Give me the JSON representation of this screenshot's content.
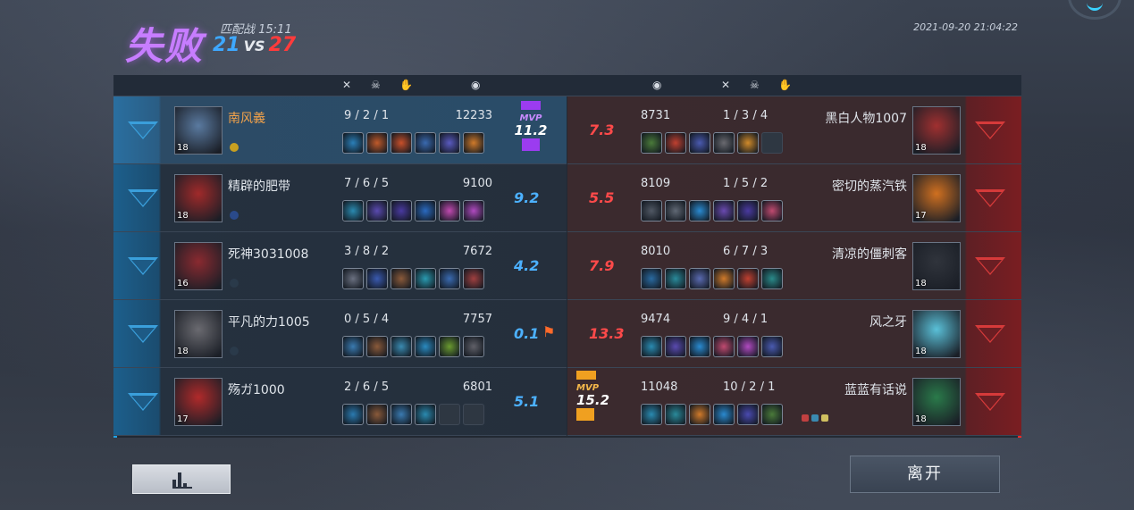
{
  "header": {
    "result": "失败",
    "mode": "匹配战 15:11",
    "score_blue": "21",
    "vs": "VS",
    "score_red": "27",
    "datetime": "2021-09-20 21:04:22"
  },
  "colors": {
    "blue_team": "#1fa4e8",
    "red_team": "#ff2a2a",
    "mvp_loser": "#9b3cf0",
    "mvp_winner": "#f0a020",
    "self_name": "#f2a24a"
  },
  "column_icons": [
    "crossed-swords-icon",
    "skull-icon",
    "assist-hand-icon",
    "coin-icon"
  ],
  "blue_team": [
    {
      "name": "南风義",
      "level": "18",
      "kda": "9 / 2 / 1",
      "gold": "12233",
      "score": "11.2",
      "mvp": "MVP",
      "is_self": true,
      "portrait_color": "#5a7aa0",
      "items": [
        "#2a7fb8",
        "#c05a2a",
        "#c8502a",
        "#3a6ab0",
        "#5a5ac0",
        "#d07a2a"
      ]
    },
    {
      "name": "精辟的肥带",
      "level": "18",
      "kda": "7 / 6 / 5",
      "gold": "9100",
      "score": "9.2",
      "portrait_color": "#a02a2a",
      "items": [
        "#2a8ab0",
        "#5a4ab0",
        "#4a3aa0",
        "#2a6ac0",
        "#c04ab0",
        "#b04ac0"
      ]
    },
    {
      "name": "死神3031008",
      "level": "16",
      "kda": "3 / 8 / 2",
      "gold": "7672",
      "score": "4.2",
      "portrait_color": "#8a2a30",
      "items": [
        "#6a7080",
        "#3a5ab0",
        "#8a5a3a",
        "#2a9ab0",
        "#3a6ab0",
        "#a04040"
      ]
    },
    {
      "name": "平凡的力1005",
      "level": "18",
      "kda": "0 / 5 / 4",
      "gold": "7757",
      "score": "0.1",
      "portrait_color": "#6a6a70",
      "items": [
        "#3a7ab0",
        "#8a5a3a",
        "#3a8ab0",
        "#2a8ac0",
        "#6a9a30",
        "#606068"
      ]
    },
    {
      "name": "殇ガ1000",
      "level": "17",
      "kda": "2 / 6 / 5",
      "gold": "6801",
      "score": "5.1",
      "portrait_color": "#b02a2a",
      "items": [
        "#2a7ab0",
        "#8a5a3a",
        "#3a7ab0",
        "#2a8ab0"
      ]
    }
  ],
  "red_team": [
    {
      "name": "黑白人物1007",
      "level": "18",
      "kda": "1 / 3 / 4",
      "gold": "8731",
      "score": "7.3",
      "portrait_color": "#a03030",
      "items": [
        "#4a7a3a",
        "#c04030",
        "#4a5ab0",
        "#6a6a70",
        "#d08a2a"
      ]
    },
    {
      "name": "密切的蒸汽铁",
      "level": "17",
      "kda": "1 / 5 / 2",
      "gold": "8109",
      "score": "5.5",
      "portrait_color": "#d07020",
      "items": [
        "#505864",
        "#606874",
        "#2a8ad0",
        "#6a4ab0",
        "#4a3aa0",
        "#c04a70"
      ]
    },
    {
      "name": "清凉的僵刺客",
      "level": "18",
      "kda": "6 / 7 / 3",
      "gold": "8010",
      "score": "7.9",
      "portrait_color": "#30343c",
      "items": [
        "#2a6aa0",
        "#2a8a9a",
        "#5a6ab0",
        "#d07a2a",
        "#c04030",
        "#2a8a8a"
      ]
    },
    {
      "name": "风之牙",
      "level": "18",
      "kda": "9 / 4 / 1",
      "gold": "9474",
      "score": "13.3",
      "portrait_color": "#5ac0d8",
      "items": [
        "#2a8ab0",
        "#5a4ab0",
        "#2a8ad0",
        "#c04a70",
        "#b04ac0",
        "#4a5ab0"
      ]
    },
    {
      "name": "蓝蓝有话说",
      "level": "18",
      "kda": "10 / 2 / 1",
      "gold": "11048",
      "score": "15.2",
      "mvp": "MVP",
      "portrait_color": "#2a7a4a",
      "items": [
        "#2a8ab0",
        "#2a8a9a",
        "#d07a2a",
        "#2a8ad0",
        "#4a4ab0",
        "#4a7a3a"
      ]
    }
  ],
  "buttons": {
    "leave": "离开",
    "stats_icon": "bar-chart-icon"
  }
}
